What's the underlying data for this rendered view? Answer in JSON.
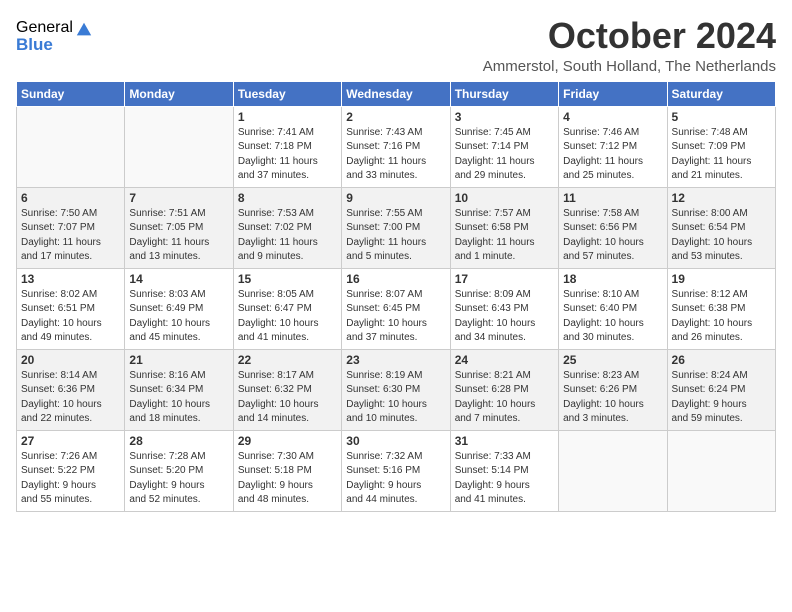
{
  "logo": {
    "general": "General",
    "blue": "Blue"
  },
  "title": "October 2024",
  "location": "Ammerstol, South Holland, The Netherlands",
  "weekdays": [
    "Sunday",
    "Monday",
    "Tuesday",
    "Wednesday",
    "Thursday",
    "Friday",
    "Saturday"
  ],
  "weeks": [
    [
      {
        "day": "",
        "info": ""
      },
      {
        "day": "",
        "info": ""
      },
      {
        "day": "1",
        "info": "Sunrise: 7:41 AM\nSunset: 7:18 PM\nDaylight: 11 hours\nand 37 minutes."
      },
      {
        "day": "2",
        "info": "Sunrise: 7:43 AM\nSunset: 7:16 PM\nDaylight: 11 hours\nand 33 minutes."
      },
      {
        "day": "3",
        "info": "Sunrise: 7:45 AM\nSunset: 7:14 PM\nDaylight: 11 hours\nand 29 minutes."
      },
      {
        "day": "4",
        "info": "Sunrise: 7:46 AM\nSunset: 7:12 PM\nDaylight: 11 hours\nand 25 minutes."
      },
      {
        "day": "5",
        "info": "Sunrise: 7:48 AM\nSunset: 7:09 PM\nDaylight: 11 hours\nand 21 minutes."
      }
    ],
    [
      {
        "day": "6",
        "info": "Sunrise: 7:50 AM\nSunset: 7:07 PM\nDaylight: 11 hours\nand 17 minutes."
      },
      {
        "day": "7",
        "info": "Sunrise: 7:51 AM\nSunset: 7:05 PM\nDaylight: 11 hours\nand 13 minutes."
      },
      {
        "day": "8",
        "info": "Sunrise: 7:53 AM\nSunset: 7:02 PM\nDaylight: 11 hours\nand 9 minutes."
      },
      {
        "day": "9",
        "info": "Sunrise: 7:55 AM\nSunset: 7:00 PM\nDaylight: 11 hours\nand 5 minutes."
      },
      {
        "day": "10",
        "info": "Sunrise: 7:57 AM\nSunset: 6:58 PM\nDaylight: 11 hours\nand 1 minute."
      },
      {
        "day": "11",
        "info": "Sunrise: 7:58 AM\nSunset: 6:56 PM\nDaylight: 10 hours\nand 57 minutes."
      },
      {
        "day": "12",
        "info": "Sunrise: 8:00 AM\nSunset: 6:54 PM\nDaylight: 10 hours\nand 53 minutes."
      }
    ],
    [
      {
        "day": "13",
        "info": "Sunrise: 8:02 AM\nSunset: 6:51 PM\nDaylight: 10 hours\nand 49 minutes."
      },
      {
        "day": "14",
        "info": "Sunrise: 8:03 AM\nSunset: 6:49 PM\nDaylight: 10 hours\nand 45 minutes."
      },
      {
        "day": "15",
        "info": "Sunrise: 8:05 AM\nSunset: 6:47 PM\nDaylight: 10 hours\nand 41 minutes."
      },
      {
        "day": "16",
        "info": "Sunrise: 8:07 AM\nSunset: 6:45 PM\nDaylight: 10 hours\nand 37 minutes."
      },
      {
        "day": "17",
        "info": "Sunrise: 8:09 AM\nSunset: 6:43 PM\nDaylight: 10 hours\nand 34 minutes."
      },
      {
        "day": "18",
        "info": "Sunrise: 8:10 AM\nSunset: 6:40 PM\nDaylight: 10 hours\nand 30 minutes."
      },
      {
        "day": "19",
        "info": "Sunrise: 8:12 AM\nSunset: 6:38 PM\nDaylight: 10 hours\nand 26 minutes."
      }
    ],
    [
      {
        "day": "20",
        "info": "Sunrise: 8:14 AM\nSunset: 6:36 PM\nDaylight: 10 hours\nand 22 minutes."
      },
      {
        "day": "21",
        "info": "Sunrise: 8:16 AM\nSunset: 6:34 PM\nDaylight: 10 hours\nand 18 minutes."
      },
      {
        "day": "22",
        "info": "Sunrise: 8:17 AM\nSunset: 6:32 PM\nDaylight: 10 hours\nand 14 minutes."
      },
      {
        "day": "23",
        "info": "Sunrise: 8:19 AM\nSunset: 6:30 PM\nDaylight: 10 hours\nand 10 minutes."
      },
      {
        "day": "24",
        "info": "Sunrise: 8:21 AM\nSunset: 6:28 PM\nDaylight: 10 hours\nand 7 minutes."
      },
      {
        "day": "25",
        "info": "Sunrise: 8:23 AM\nSunset: 6:26 PM\nDaylight: 10 hours\nand 3 minutes."
      },
      {
        "day": "26",
        "info": "Sunrise: 8:24 AM\nSunset: 6:24 PM\nDaylight: 9 hours\nand 59 minutes."
      }
    ],
    [
      {
        "day": "27",
        "info": "Sunrise: 7:26 AM\nSunset: 5:22 PM\nDaylight: 9 hours\nand 55 minutes."
      },
      {
        "day": "28",
        "info": "Sunrise: 7:28 AM\nSunset: 5:20 PM\nDaylight: 9 hours\nand 52 minutes."
      },
      {
        "day": "29",
        "info": "Sunrise: 7:30 AM\nSunset: 5:18 PM\nDaylight: 9 hours\nand 48 minutes."
      },
      {
        "day": "30",
        "info": "Sunrise: 7:32 AM\nSunset: 5:16 PM\nDaylight: 9 hours\nand 44 minutes."
      },
      {
        "day": "31",
        "info": "Sunrise: 7:33 AM\nSunset: 5:14 PM\nDaylight: 9 hours\nand 41 minutes."
      },
      {
        "day": "",
        "info": ""
      },
      {
        "day": "",
        "info": ""
      }
    ]
  ]
}
